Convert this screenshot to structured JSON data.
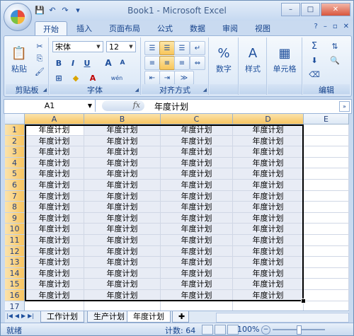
{
  "window": {
    "title": "Book1 - Microsoft Excel"
  },
  "qat": {
    "save_icon": "save-icon",
    "undo_icon": "undo-icon",
    "redo_icon": "redo-icon",
    "customize": "▾"
  },
  "tabs": [
    "开始",
    "插入",
    "页面布局",
    "公式",
    "数据",
    "审阅",
    "视图"
  ],
  "ribbon": {
    "clipboard": {
      "label": "剪贴板",
      "paste": "粘贴"
    },
    "font": {
      "label": "字体",
      "name": "宋体",
      "size": "12",
      "bold": "B",
      "italic": "I",
      "underline": "U",
      "grow": "A",
      "shrink": "A",
      "wen": "wén"
    },
    "alignment": {
      "label": "对齐方式"
    },
    "number": {
      "label": "",
      "button": "数字"
    },
    "styles": {
      "button": "样式"
    },
    "cells": {
      "button": "单元格"
    },
    "editing": {
      "label": "编辑",
      "sum": "Σ"
    }
  },
  "formula_bar": {
    "name_box": "A1",
    "fx": "fx",
    "value": "年度计划"
  },
  "sheet": {
    "columns": [
      "A",
      "B",
      "C",
      "D",
      "E"
    ],
    "rows": [
      "1",
      "2",
      "3",
      "4",
      "5",
      "6",
      "7",
      "8",
      "9",
      "10",
      "11",
      "12",
      "13",
      "14",
      "15",
      "16",
      "17"
    ],
    "cell_text": "年度计划"
  },
  "sheet_tabs": [
    "工作计划",
    "生产计划",
    "年度计划"
  ],
  "status": {
    "ready": "就绪",
    "count": "计数: 64",
    "zoom": "100%",
    "zoom_minus": "−"
  }
}
